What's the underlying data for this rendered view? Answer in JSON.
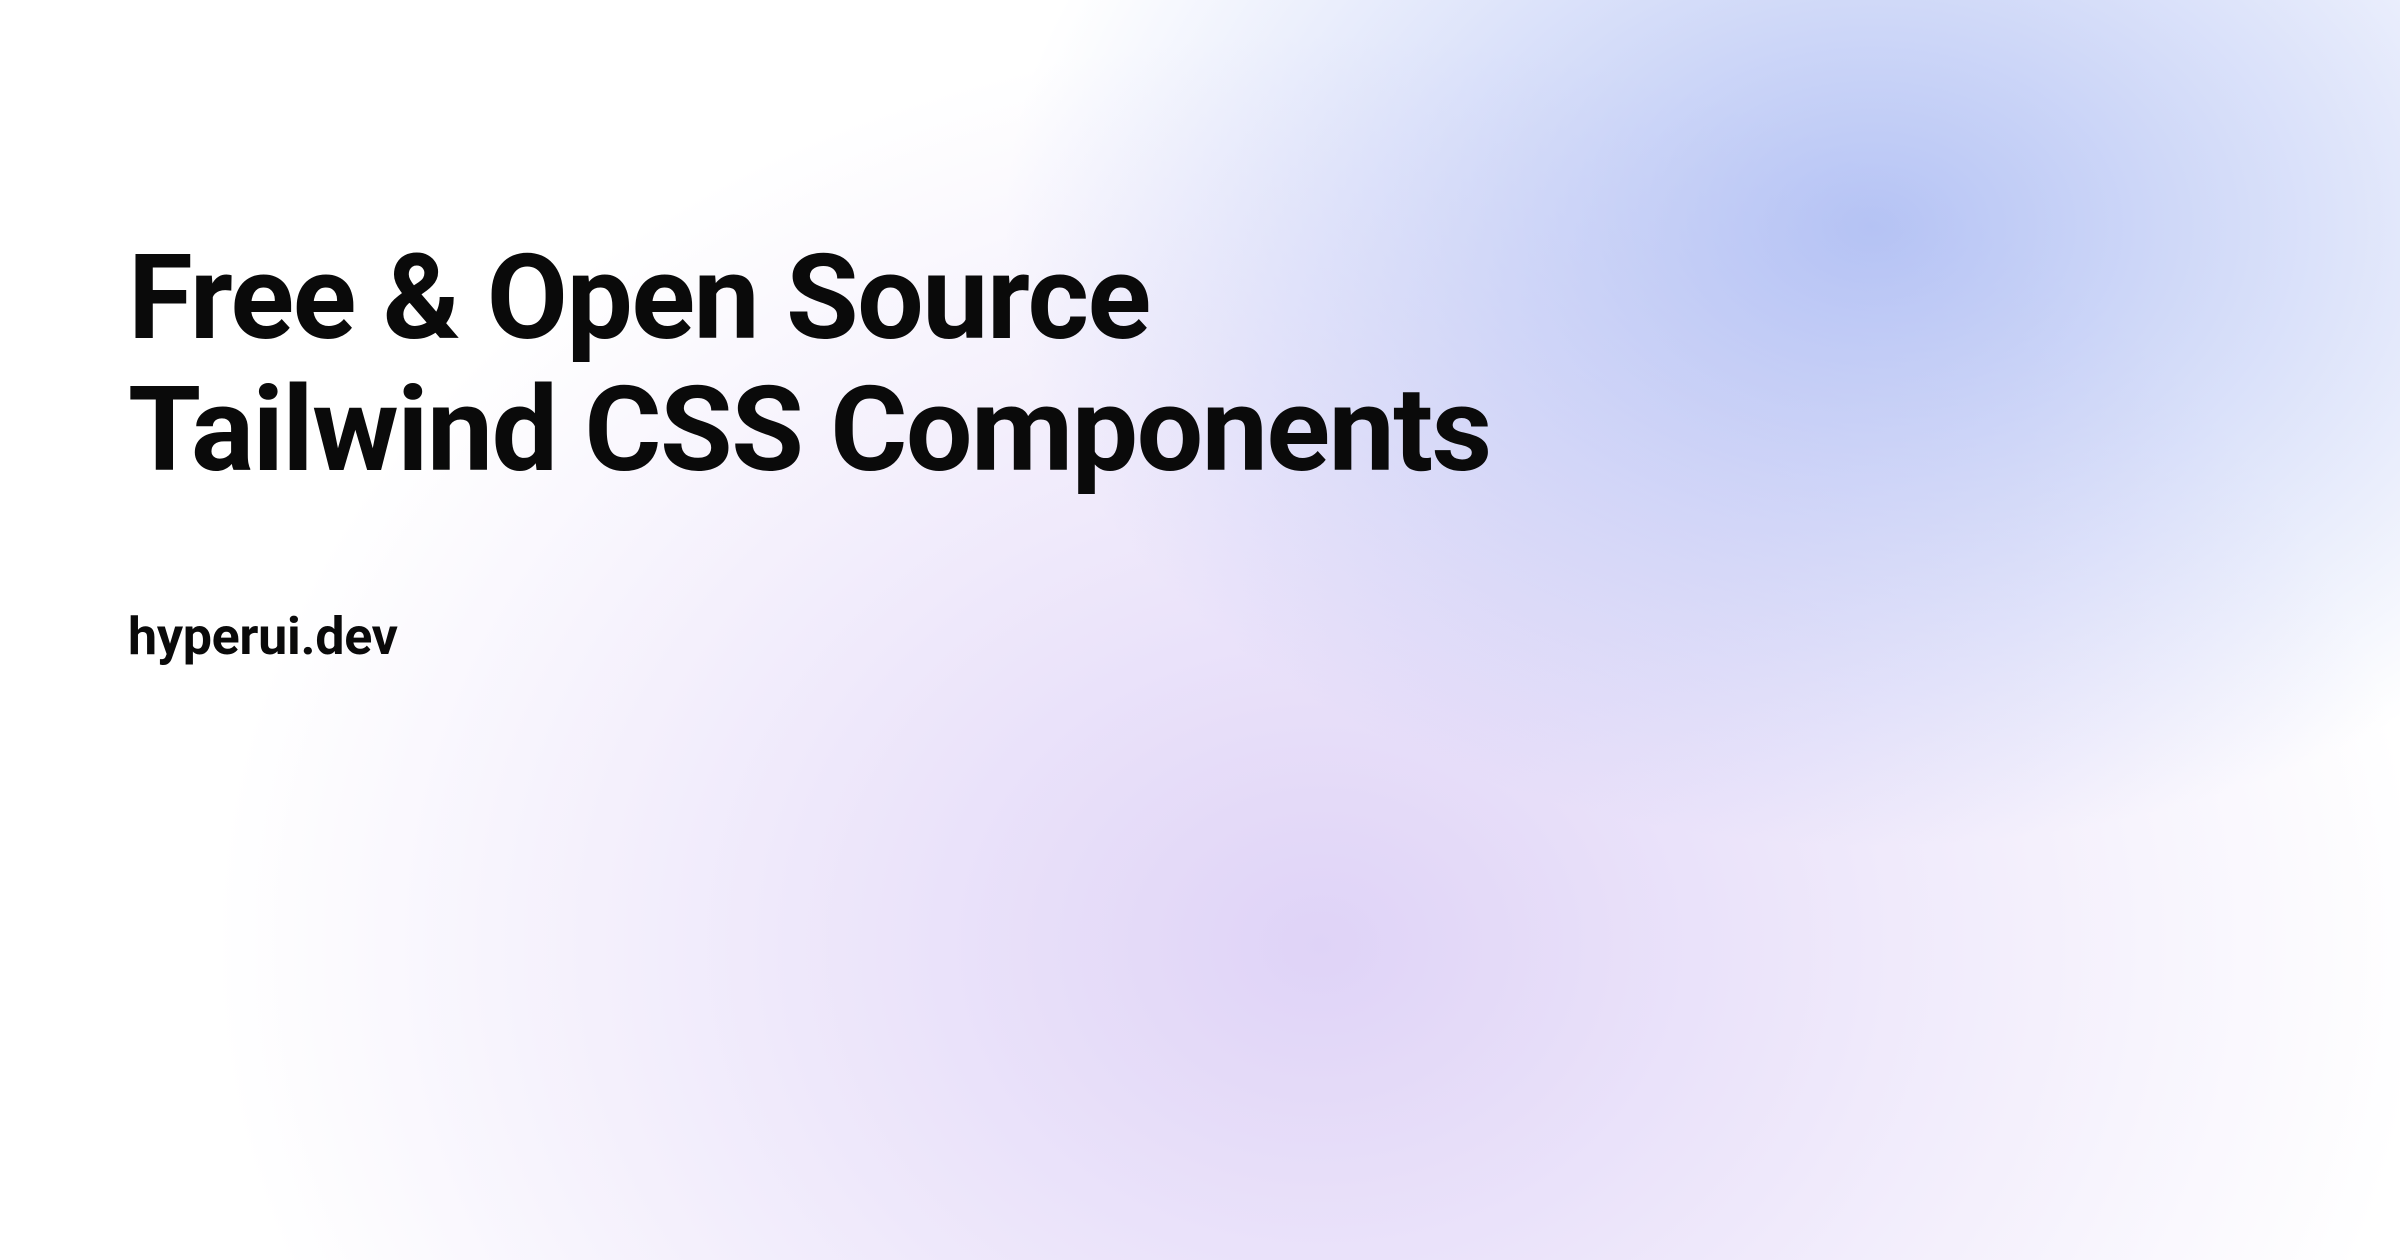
{
  "hero": {
    "line1": "Free & Open Source",
    "line2": "Tailwind CSS Components",
    "domain": "hyperui.dev"
  }
}
